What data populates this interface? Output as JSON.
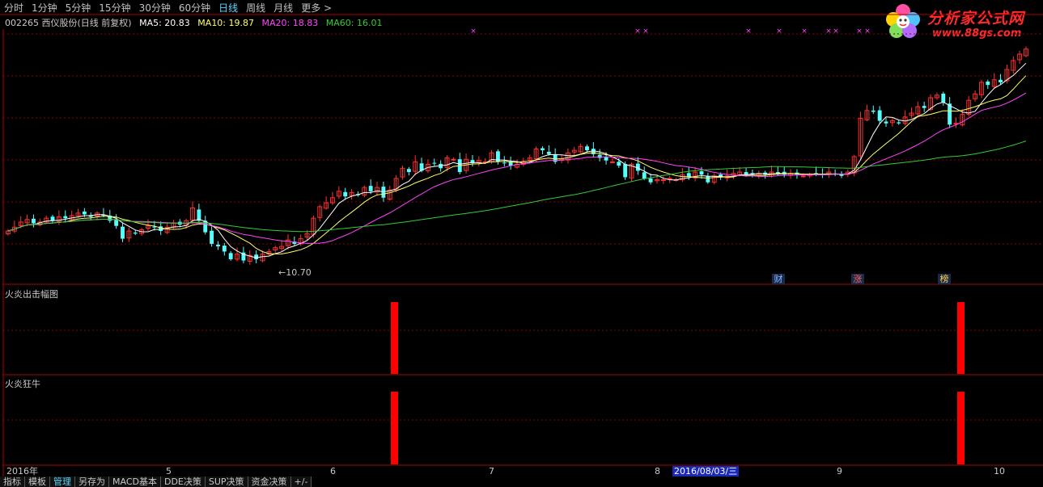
{
  "toolbar": {
    "tabs": [
      {
        "label": "分时",
        "active": false
      },
      {
        "label": "1分钟",
        "active": false
      },
      {
        "label": "5分钟",
        "active": false
      },
      {
        "label": "15分钟",
        "active": false
      },
      {
        "label": "30分钟",
        "active": false
      },
      {
        "label": "60分钟",
        "active": false
      },
      {
        "label": "日线",
        "active": true
      },
      {
        "label": "周线",
        "active": false
      },
      {
        "label": "月线",
        "active": false
      },
      {
        "label": "更多 >",
        "active": false
      }
    ]
  },
  "logo": {
    "name": "分析家公式网",
    "url": "www.88gs.com"
  },
  "info": {
    "stock": "002265 西仪股份(日线 前复权)",
    "ma5": "MA5: 20.83",
    "ma10": "MA10: 19.87",
    "ma20": "MA20: 18.83",
    "ma60": "MA60: 16.01"
  },
  "colors": {
    "up": "#ff3030",
    "down": "#54ffff",
    "ma5": "#ffffff",
    "ma10": "#ffff66",
    "ma20": "#ff44ff",
    "ma60": "#33cc33",
    "grid": "#8b0000",
    "signal": "#ff0000"
  },
  "main_chart": {
    "low_label": "10.70",
    "event_badges": [
      {
        "label": "财",
        "color": "#8ab4ff"
      },
      {
        "label": "涨",
        "color": "#ff6060"
      },
      {
        "label": "榜",
        "color": "#ffd040"
      }
    ]
  },
  "panel1": {
    "title": "火炎出击幅图"
  },
  "panel2": {
    "title": "火炎狂牛"
  },
  "x_axis": {
    "labels": [
      "2016年",
      "5",
      "6",
      "7",
      "8",
      "9",
      "10"
    ],
    "cursor_date": "2016/08/03/三"
  },
  "bottom_tabs": [
    {
      "label": "指标",
      "active": false
    },
    {
      "label": "模板",
      "active": false
    },
    {
      "label": "管理",
      "active": true
    },
    {
      "label": "另存为",
      "active": false
    },
    {
      "label": "MACD基本",
      "active": false
    },
    {
      "label": "DDE决策",
      "active": false
    },
    {
      "label": "SUP决策",
      "active": false
    },
    {
      "label": "资金决策",
      "active": false
    },
    {
      "label": "+/-",
      "active": false
    }
  ],
  "chart_data": {
    "type": "candlestick",
    "title": "002265 西仪股份(日线 前复权)",
    "period": "daily",
    "price_min_label": "10.70",
    "closes": [
      13.2,
      13.5,
      13.9,
      14.1,
      13.8,
      13.9,
      14.2,
      14.0,
      14.3,
      14.2,
      14.4,
      14.6,
      14.5,
      14.3,
      14.6,
      14.4,
      14.0,
      13.6,
      12.6,
      13.2,
      13.0,
      13.3,
      13.6,
      13.5,
      13.2,
      13.5,
      13.8,
      13.7,
      14.0,
      15.0,
      14.0,
      13.1,
      12.2,
      12.0,
      11.6,
      11.0,
      11.4,
      10.9,
      11.3,
      11.0,
      11.4,
      11.6,
      11.9,
      12.0,
      12.5,
      12.2,
      12.6,
      13.0,
      14.2,
      15.1,
      15.4,
      15.8,
      16.3,
      15.9,
      16.2,
      16.0,
      16.6,
      16.3,
      16.6,
      15.8,
      16.4,
      17.3,
      18.1,
      17.8,
      18.6,
      17.9,
      18.4,
      18.5,
      18.1,
      18.9,
      18.8,
      17.8,
      18.8,
      18.5,
      18.7,
      18.6,
      19.3,
      18.6,
      18.5,
      18.3,
      18.4,
      18.6,
      18.9,
      19.6,
      19.5,
      19.2,
      18.6,
      18.8,
      19.3,
      19.5,
      19.8,
      19.5,
      19.2,
      18.9,
      18.7,
      18.6,
      18.3,
      17.4,
      18.4,
      17.9,
      17.3,
      17.0,
      17.2,
      17.2,
      17.3,
      17.2,
      17.6,
      17.4,
      17.8,
      17.6,
      17.0,
      17.5,
      17.4,
      17.5,
      17.7,
      17.8,
      17.6,
      17.6,
      17.7,
      17.6,
      17.8,
      17.7,
      17.6,
      17.7,
      17.6,
      17.5,
      17.6,
      17.7,
      17.6,
      17.8,
      17.6,
      17.5,
      17.8,
      19.0,
      22.0,
      22.6,
      22.5,
      21.8,
      21.6,
      21.8,
      21.6,
      22.1,
      22.4,
      22.9,
      22.8,
      23.6,
      23.8,
      23.2,
      21.5,
      21.6,
      22.3,
      23.4,
      23.9,
      24.8,
      24.6,
      25.0,
      24.8,
      25.8,
      26.5,
      27.0,
      27.4
    ],
    "ma_values": {
      "MA5": 20.83,
      "MA10": 19.87,
      "MA20": 18.83,
      "MA60": 16.01
    },
    "indicator_panels": [
      {
        "name": "火炎出击幅图",
        "signal_dates": [
          "2016-06",
          "2016-09"
        ]
      },
      {
        "name": "火炎狂牛",
        "signal_dates": [
          "2016-06",
          "2016-09"
        ]
      }
    ]
  }
}
